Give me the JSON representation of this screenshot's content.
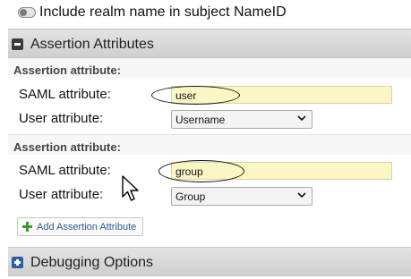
{
  "toggle": {
    "label": "Include realm name in subject NameID",
    "enabled": false
  },
  "assertion_panel": {
    "title": "Assertion Attributes",
    "icon": "collapse-minus-icon",
    "groups": [
      {
        "heading": "Assertion attribute:",
        "saml_label": "SAML attribute:",
        "saml_value": "user",
        "user_label": "User attribute:",
        "user_value": "Username"
      },
      {
        "heading": "Assertion attribute:",
        "saml_label": "SAML attribute:",
        "saml_value": "group",
        "user_label": "User attribute:",
        "user_value": "Group"
      }
    ],
    "add_button": "Add Assertion Attribute"
  },
  "debug_panel": {
    "title": "Debugging Options",
    "icon": "expand-plus-icon"
  },
  "colors": {
    "input_bg": "#fbf7c4",
    "header_bg": "#d9d9d9",
    "link": "#2a5d8f",
    "add_green": "#3c9a2f",
    "expand_blue": "#2f5fa0"
  }
}
